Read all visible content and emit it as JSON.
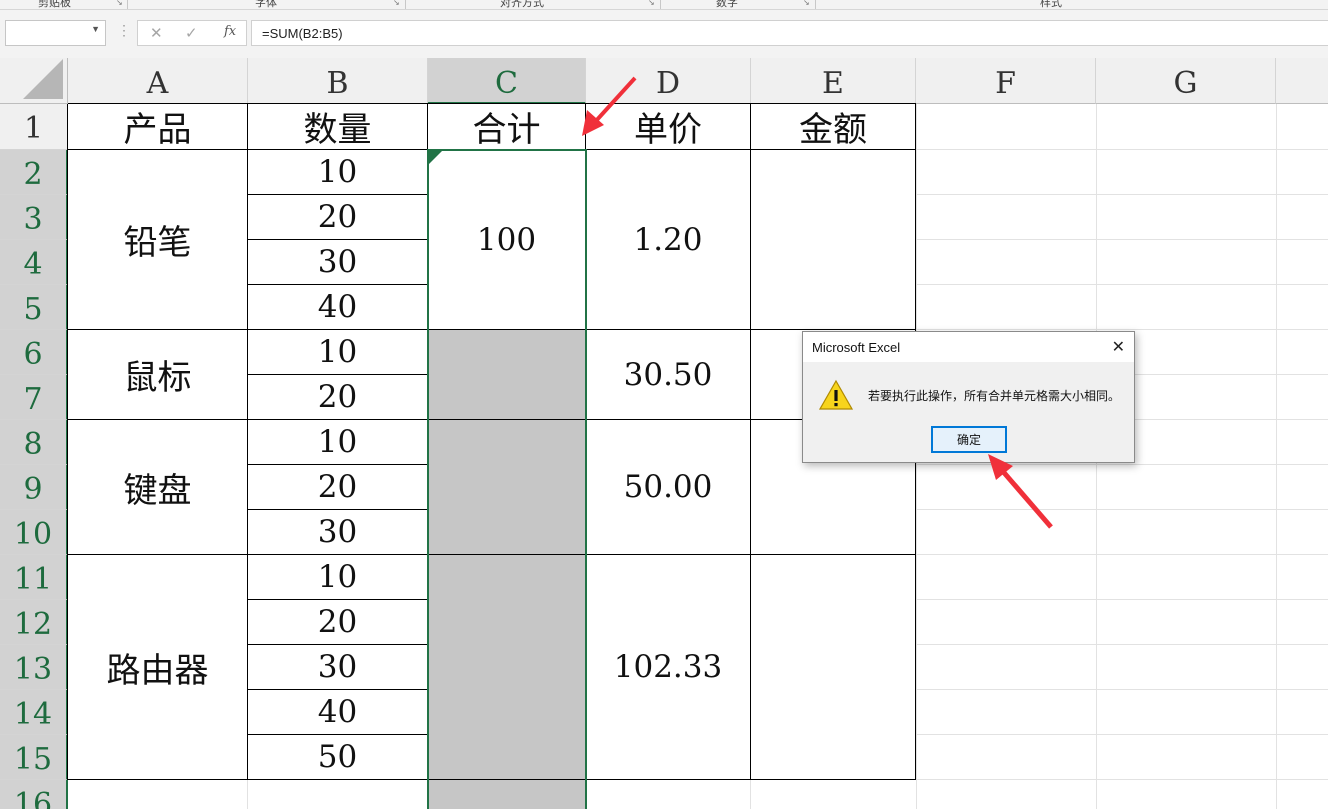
{
  "ribbon": {
    "groups": [
      "剪贴板",
      "字体",
      "对齐方式",
      "数字",
      "样式"
    ]
  },
  "formula_bar": {
    "name_box_value": "",
    "cancel_icon": "✕",
    "enter_icon": "✓",
    "fx_label": "fx",
    "formula": "=SUM(B2:B5)"
  },
  "columns": [
    "A",
    "B",
    "C",
    "D",
    "E",
    "F",
    "G"
  ],
  "selected_column": "C",
  "rows": [
    "1",
    "2",
    "3",
    "4",
    "5",
    "6",
    "7",
    "8",
    "9",
    "10",
    "11",
    "12",
    "13",
    "14",
    "15",
    "16"
  ],
  "headers": {
    "a1": "产品",
    "b1": "数量",
    "c1": "合计",
    "d1": "单价",
    "e1": "金额"
  },
  "products": [
    {
      "name": "铅笔",
      "quantities": [
        "10",
        "20",
        "30",
        "40"
      ],
      "total": "100",
      "unit_price": "1.20"
    },
    {
      "name": "鼠标",
      "quantities": [
        "10",
        "20"
      ],
      "total": "",
      "unit_price": "30.50"
    },
    {
      "name": "键盘",
      "quantities": [
        "10",
        "20",
        "30"
      ],
      "total": "",
      "unit_price": "50.00"
    },
    {
      "name": "路由器",
      "quantities": [
        "10",
        "20",
        "30",
        "40",
        "50"
      ],
      "total": "",
      "unit_price": "102.33"
    }
  ],
  "dialog": {
    "title": "Microsoft Excel",
    "close_icon": "✕",
    "icon": "warning-icon",
    "message": "若要执行此操作，所有合并单元格需大小相同。",
    "ok_label": "确定"
  },
  "colors": {
    "selection": "#217346",
    "annotation_arrow": "#f0303a",
    "dialog_button_border": "#0078d7"
  }
}
